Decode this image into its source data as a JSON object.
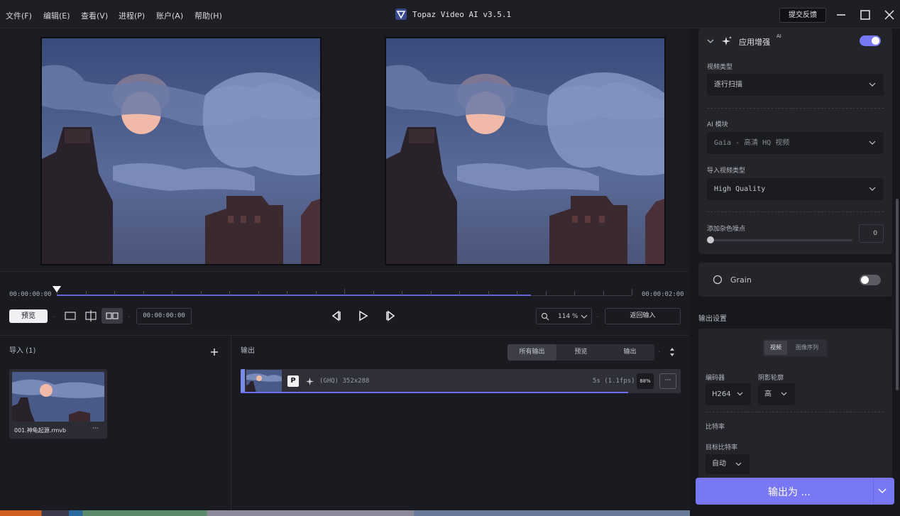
{
  "app": {
    "title": "Topaz Video AI  v3.5.1",
    "feedback_label": "提交反馈"
  },
  "menu": [
    "文件(F)",
    "编辑(E)",
    "查看(V)",
    "进程(P)",
    "账户(A)",
    "帮助(H)"
  ],
  "timeline": {
    "start_time": "00:00:00:00",
    "end_time": "00:00:02:00",
    "progress_fraction": 0.825,
    "playhead_fraction": 0.0
  },
  "controls": {
    "preview_label": "预览",
    "current_time": "00:00:00:00",
    "zoom": "114 %",
    "return_input_label": "返回输入"
  },
  "import_panel": {
    "title": "导入 (1)",
    "file_name": "001.神龟起源.rmvb",
    "more_label": "···"
  },
  "output_panel": {
    "title": "输出",
    "tabs": [
      "所有输出",
      "预览",
      "输出"
    ],
    "active_tab": "所有输出",
    "item": {
      "badge": "P",
      "info": "(GHQ) 352x288",
      "duration": "5s (1.1fps)",
      "percent": "88%",
      "more_label": "···",
      "progress_fraction": 0.88
    }
  },
  "enhance": {
    "title": "应用增强",
    "ai_badge": "AI",
    "enabled": true,
    "video_type_label": "视频类型",
    "video_type_value": "逐行扫描",
    "ai_model_label": "AI 模块",
    "ai_model_value": "Gaia - 高清 HQ 视频",
    "input_type_label": "导入视频类型",
    "input_type_value": "High Quality",
    "noise_label": "添加杂色噪点",
    "noise_value": "0",
    "noise_fraction": 0.0
  },
  "grain": {
    "title": "Grain",
    "enabled": false
  },
  "output_settings": {
    "title": "输出设置",
    "mode_tabs": [
      "视频",
      "图像序列"
    ],
    "active_mode": "视频",
    "encoder_label": "编码器",
    "encoder_value": "H264",
    "profile_label": "阴影轮廓",
    "profile_value": "高",
    "bitrate_label": "比特率",
    "target_bitrate_label": "目标比特率",
    "target_bitrate_value": "自动"
  },
  "export": {
    "label": "输出为 ..."
  },
  "colors": {
    "accent": "#7878f5",
    "progress": "#6666e0",
    "panel_bg": "#24252b",
    "app_bg": "#1b1c22"
  }
}
